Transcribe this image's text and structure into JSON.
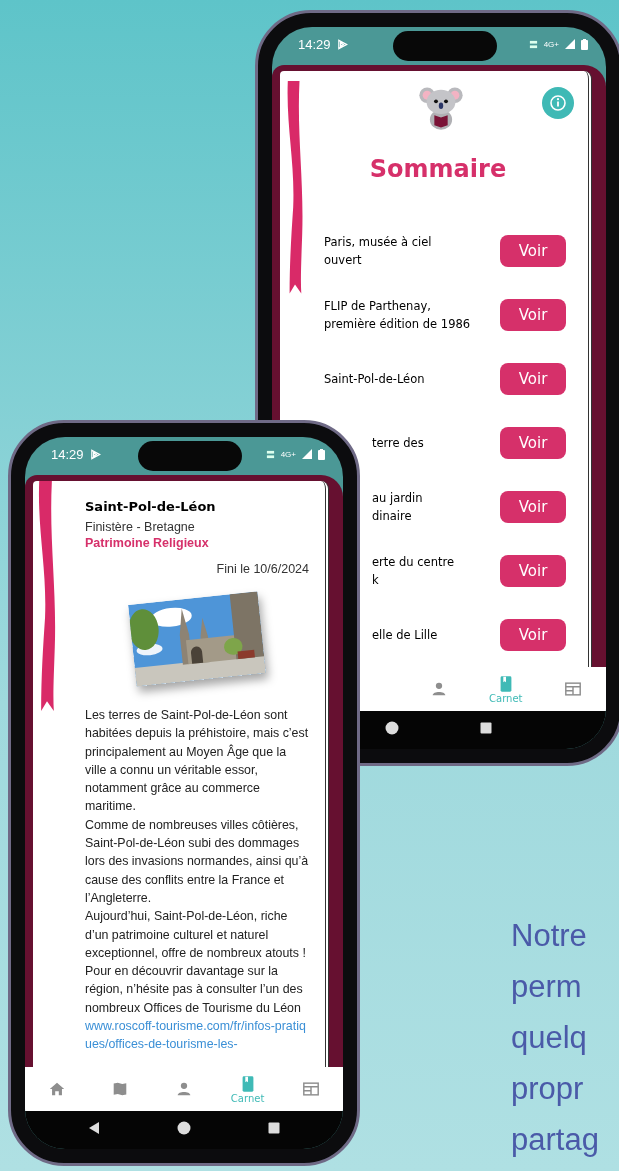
{
  "back_phone": {
    "status_bar": {
      "time": "14:29",
      "network": "4G+"
    },
    "title": "Sommaire",
    "entries": [
      {
        "title": "Paris, musée à ciel\nouvert",
        "button": "Voir",
        "cut": false
      },
      {
        "title": "FLIP de Parthenay,\npremière édition de 1986",
        "button": "Voir",
        "cut": false
      },
      {
        "title": "Saint-Pol-de-Léon",
        "button": "Voir",
        "cut": false
      },
      {
        "title": "terre des",
        "button": "Voir",
        "cut": true
      },
      {
        "title": "au jardin\ndinaire",
        "button": "Voir",
        "cut": true
      },
      {
        "title": "erte du centre\nk",
        "button": "Voir",
        "cut": true
      },
      {
        "title": "elle de Lille",
        "button": "Voir",
        "cut": true
      }
    ],
    "nav": [
      {
        "kind": "person",
        "selected": false
      },
      {
        "kind": "book",
        "label": "Carnet",
        "selected": true
      },
      {
        "kind": "calendar",
        "selected": false
      }
    ]
  },
  "front_phone": {
    "status_bar": {
      "time": "14:29",
      "network": "4G+"
    },
    "place": {
      "title": "Saint-Pol-de-Léon",
      "region": "Finistère - Bretagne",
      "category": "Patrimoine Religieux",
      "finished": "Fini le 10/6/2024",
      "paragraphs": [
        "Les terres de Saint-Pol-de-Léon sont habitées depuis la préhistoire, mais c’est principalement au Moyen Âge que la ville a connu un véritable essor, notamment grâce au commerce maritime.",
        "Comme de nombreuses villes côtières, Saint-Pol-de-Léon subi des dommages lors des invasions normandes, ainsi qu’à cause des conflits entre la France et l’Angleterre.",
        "Aujourd’hui, Saint-Pol-de-Léon, riche d’un patrimoine culturel et naturel exceptionnel, offre de nombreux atouts ! Pour en découvrir davantage sur la région, n’hésite pas à consulter l’un des nombreux Offices de Tourisme du Léon"
      ],
      "link": "www.roscoff-tourisme.com/fr/infos-pratiques/offices-de-tourisme-les-"
    },
    "nav": [
      {
        "kind": "home",
        "selected": false
      },
      {
        "kind": "map",
        "selected": false
      },
      {
        "kind": "person",
        "selected": false
      },
      {
        "kind": "book",
        "label": "Carnet",
        "selected": true
      },
      {
        "kind": "calendar",
        "selected": false
      }
    ]
  },
  "tagline": [
    "Notre",
    "perm",
    "quelq",
    "propr",
    "partag"
  ]
}
